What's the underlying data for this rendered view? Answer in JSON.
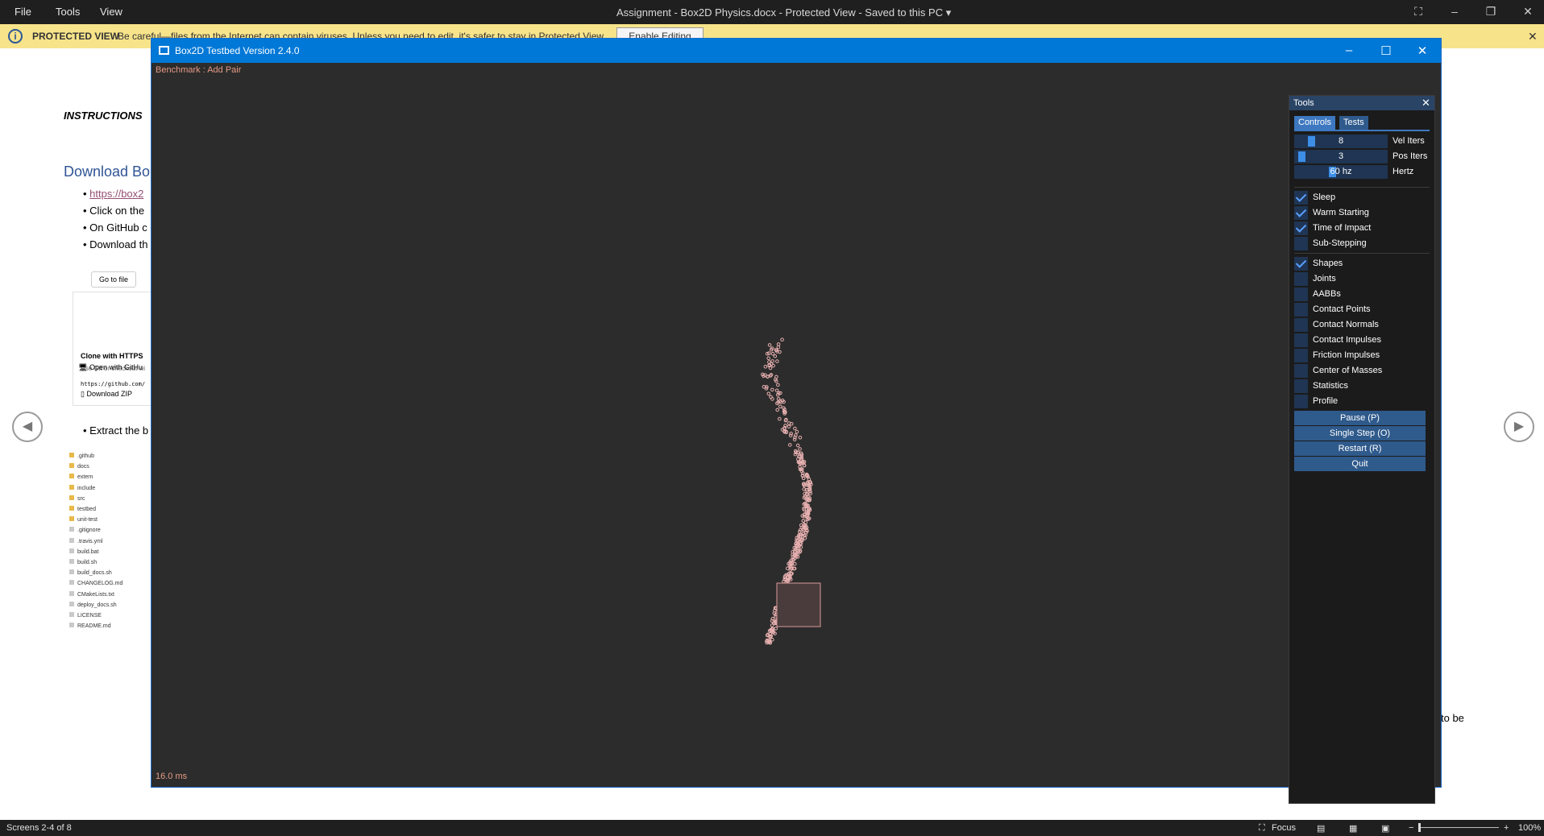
{
  "word": {
    "menu": [
      "File",
      "Tools",
      "View"
    ],
    "doc_title": "Assignment - Box2D Physics.docx  -  Protected View  -  Saved to this PC  ▾",
    "protected_label": "PROTECTED VIEW",
    "protected_msg": "Be careful—files from the Internet can contain viruses. Unless you need to edit, it's safer to stay in Protected View.",
    "enable_editing": "Enable Editing",
    "doc": {
      "instructions": "INSTRUCTIONS",
      "heading": "Download Bo",
      "bullets": [
        "https://box2",
        "Click on the",
        "On GitHub c",
        "Download th",
        "Extract the b"
      ],
      "go_to_file": "Go to file",
      "clone_title": "Clone with HTTPS",
      "clone_sub": "Use Git or checkout wi",
      "clone_url": "https://github.com/",
      "open_github": "Open with GitHu",
      "download_zip": "Download ZIP",
      "files": [
        ".github",
        "docs",
        "extern",
        "include",
        "src",
        "testbed",
        "unit-test",
        ".gitignore",
        ".travis.yml",
        "build.bat",
        "build.sh",
        "build_docs.sh",
        "CHANGELOG.md",
        "CMakeLists.txt",
        "deploy_docs.sh",
        "LICENSE",
        "README.md"
      ],
      "trailing_text": "to be"
    },
    "status": {
      "screens": "Screens 2-4 of 8",
      "focus": "Focus",
      "zoom": "100%"
    }
  },
  "box2d": {
    "window_title": "Box2D Testbed Version 2.4.0",
    "benchmark": "Benchmark : Add Pair",
    "frame_time": "16.0 ms",
    "tools": {
      "title": "Tools",
      "tabs": [
        "Controls",
        "Tests"
      ],
      "sliders": [
        {
          "value": "8",
          "label": "Vel Iters",
          "level": 0.16
        },
        {
          "value": "3",
          "label": "Pos Iters",
          "level": 0.05
        },
        {
          "value": "60 hz",
          "label": "Hertz",
          "level": 0.4
        }
      ],
      "group1": [
        {
          "label": "Sleep",
          "checked": true
        },
        {
          "label": "Warm Starting",
          "checked": true
        },
        {
          "label": "Time of Impact",
          "checked": true
        },
        {
          "label": "Sub-Stepping",
          "checked": false
        }
      ],
      "group2": [
        {
          "label": "Shapes",
          "checked": true
        },
        {
          "label": "Joints",
          "checked": false
        },
        {
          "label": "AABBs",
          "checked": false
        },
        {
          "label": "Contact Points",
          "checked": false
        },
        {
          "label": "Contact Normals",
          "checked": false
        },
        {
          "label": "Contact Impulses",
          "checked": false
        },
        {
          "label": "Friction Impulses",
          "checked": false
        },
        {
          "label": "Center of Masses",
          "checked": false
        },
        {
          "label": "Statistics",
          "checked": false
        },
        {
          "label": "Profile",
          "checked": false
        }
      ],
      "buttons": [
        "Pause (P)",
        "Single Step (O)",
        "Restart (R)",
        "Quit"
      ]
    }
  }
}
